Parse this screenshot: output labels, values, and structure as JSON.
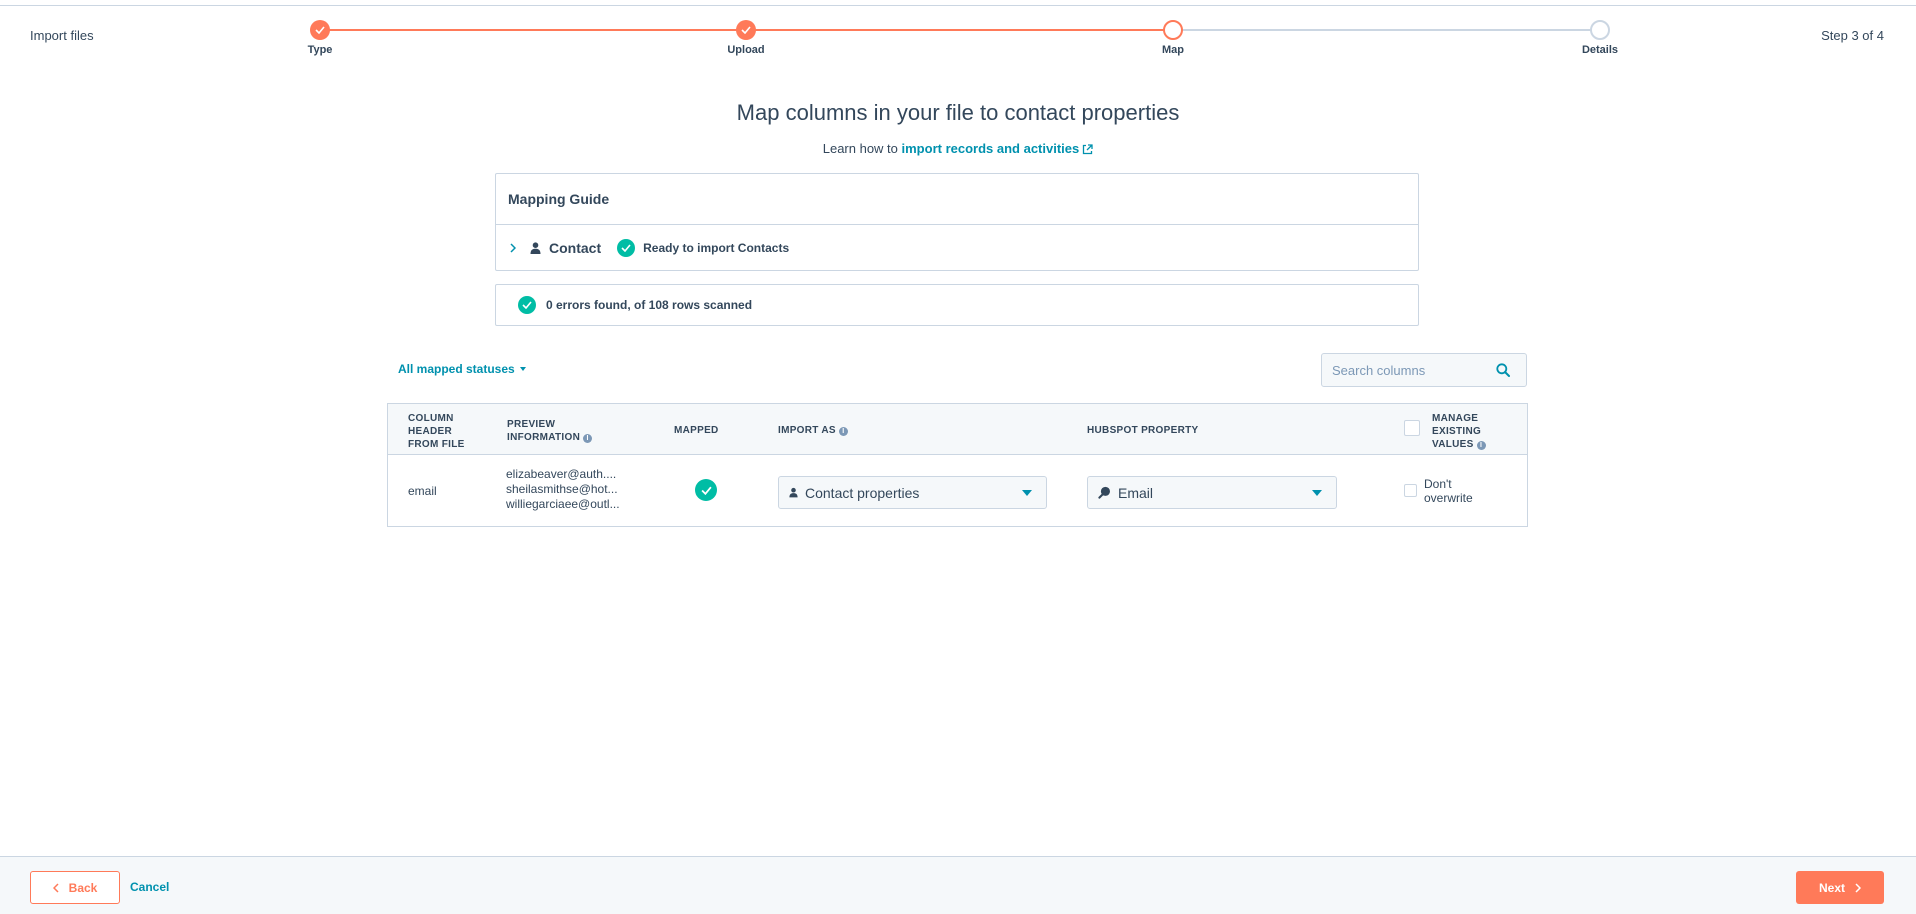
{
  "header": {
    "title": "Import files",
    "step_count": "Step 3 of 4",
    "steps": [
      {
        "label": "Type",
        "status": "done"
      },
      {
        "label": "Upload",
        "status": "done"
      },
      {
        "label": "Map",
        "status": "current"
      },
      {
        "label": "Details",
        "status": "todo"
      }
    ]
  },
  "main": {
    "title": "Map columns in your file to contact properties",
    "learn_prefix": "Learn how to ",
    "learn_link": "import records and activities"
  },
  "guide": {
    "title": "Mapping Guide",
    "object_label": "Contact",
    "status_label": "Ready to import Contacts"
  },
  "errors": {
    "label": "0 errors found, of 108 rows scanned"
  },
  "filter": {
    "label": "All mapped statuses"
  },
  "search": {
    "placeholder": "Search columns"
  },
  "table": {
    "headers": {
      "column_header": "COLUMN HEADER FROM FILE",
      "preview": "PREVIEW INFORMATION",
      "mapped": "MAPPED",
      "import_as": "IMPORT AS",
      "hubspot_property": "HUBSPOT PROPERTY",
      "manage": "MANAGE EXISTING VALUES"
    },
    "rows": [
      {
        "column": "email",
        "preview": [
          "elizabeaver@auth....",
          "sheilasmithse@hot...",
          "williegarciaee@outl..."
        ],
        "import_as": "Contact properties",
        "property": "Email",
        "manage": "Don't overwrite"
      }
    ]
  },
  "footer": {
    "back": "Back",
    "cancel": "Cancel",
    "next": "Next"
  },
  "colors": {
    "accent": "#ff7a59",
    "link": "#0091ae",
    "success": "#00bda5",
    "text": "#33475b",
    "border": "#cbd6e2"
  }
}
